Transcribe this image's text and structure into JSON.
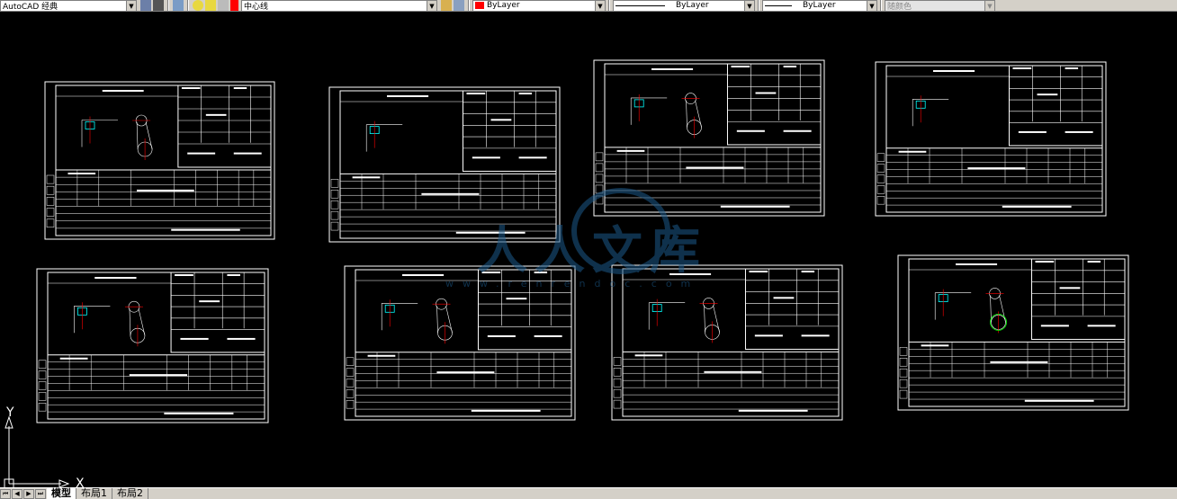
{
  "toolbar": {
    "workspace_value": "AutoCAD 经典",
    "layer_value": "中心线",
    "color_value": "ByLayer",
    "linetype_value": "ByLayer",
    "lineweight_value": "ByLayer",
    "plotstyle_value": "随颜色"
  },
  "canvas": {
    "background": "#000000",
    "sheet_count": 8
  },
  "ucs": {
    "x_label": "X",
    "y_label": "Y"
  },
  "watermark": {
    "text": "人人文库",
    "url": "www.renrendoc.com"
  },
  "layout_tabs": [
    {
      "label": "模型",
      "active": true
    },
    {
      "label": "布局1",
      "active": false
    },
    {
      "label": "布局2",
      "active": false
    }
  ],
  "colors": {
    "toolbar_bg": "#d4d0c8",
    "drawing_line": "#ffffff",
    "accent_cyan": "#00ffff",
    "accent_red": "#ff0000",
    "accent_green": "#00ff00"
  }
}
